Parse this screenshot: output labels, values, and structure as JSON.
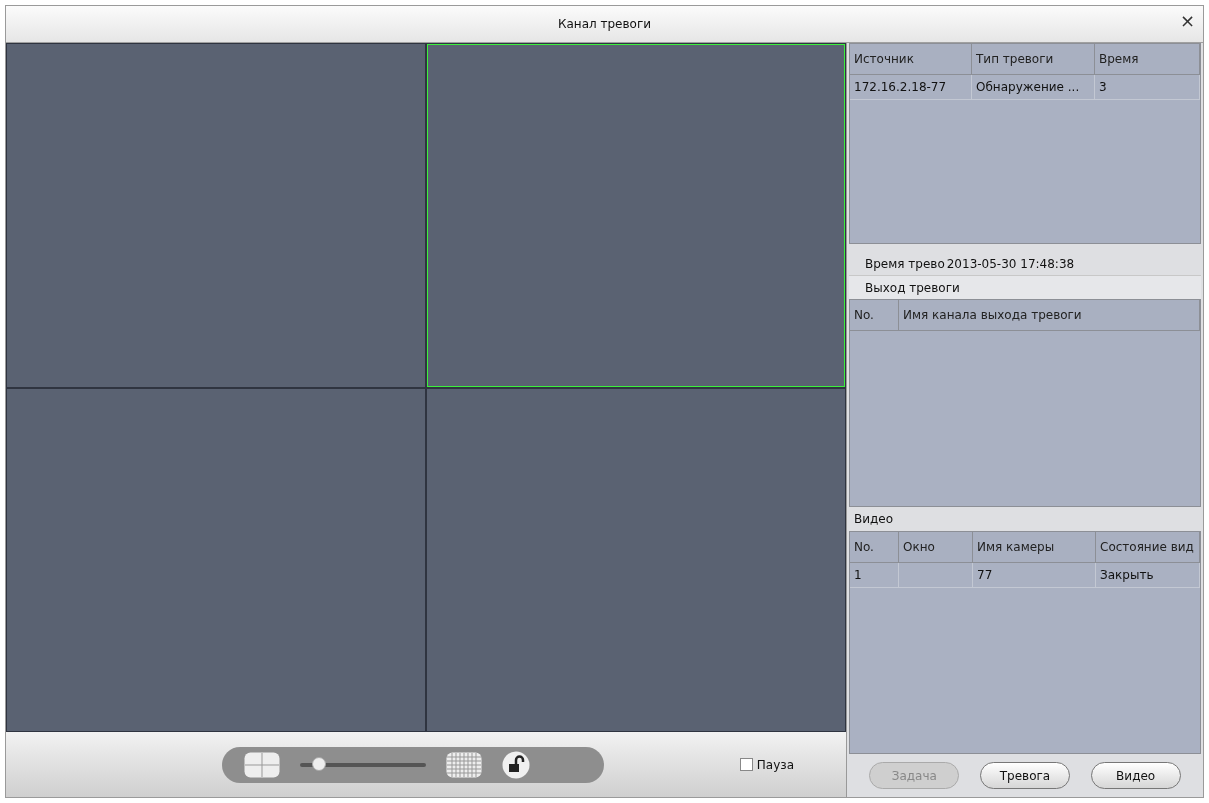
{
  "window": {
    "title": "Канал тревоги",
    "close": "×"
  },
  "video_cells": [
    {
      "selected": false
    },
    {
      "selected": true
    },
    {
      "selected": false
    },
    {
      "selected": false
    }
  ],
  "toolbar": {
    "zoom": {
      "level": 0.15
    },
    "pause": {
      "label": "Пауза",
      "checked": false
    }
  },
  "alarm_table": {
    "columns": [
      "Источник",
      "Тип тревоги",
      "Время"
    ],
    "rows": [
      [
        "172.16.2.18-77",
        "Обнаружение ...",
        "3"
      ]
    ]
  },
  "alarm_time": {
    "label": "Время трево",
    "value": "2013-05-30 17:48:38"
  },
  "alarm_output": {
    "title": "Выход тревоги",
    "columns": [
      "No.",
      "Имя канала выхода тревоги"
    ]
  },
  "video": {
    "title": "Видео",
    "columns": [
      "No.",
      "Окно",
      "Имя камеры",
      "Состояние вид"
    ],
    "rows": [
      [
        "1",
        "",
        "77",
        "Закрыть"
      ]
    ]
  },
  "buttons": [
    {
      "label": "Задача",
      "disabled": true
    },
    {
      "label": "Тревога",
      "disabled": false
    },
    {
      "label": "Видео",
      "disabled": false
    }
  ]
}
